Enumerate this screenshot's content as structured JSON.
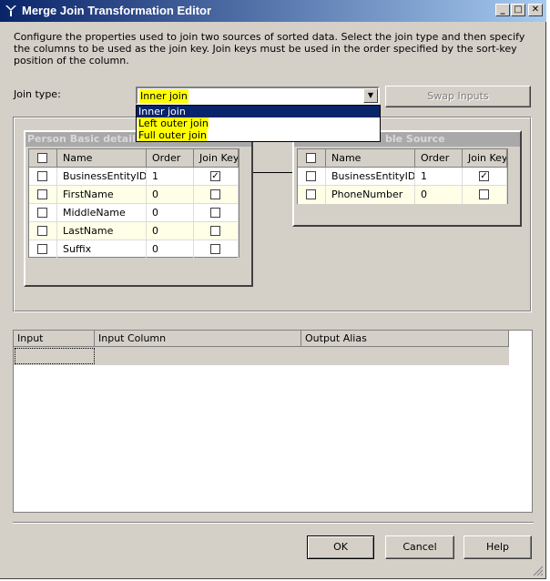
{
  "window": {
    "title": "Merge Join Transformation Editor"
  },
  "description": "Configure the properties used to join two sources of sorted data. Select the join type and then specify the columns to be used as the join key. Join keys must be used in the order specified by the sort-key position of the column.",
  "join_type": {
    "label": "Join type:",
    "selected": "Inner join",
    "options": [
      "Inner join",
      "Left outer join",
      "Full outer join"
    ]
  },
  "swap_inputs_label": "Swap Inputs",
  "left_table": {
    "title": "Person Basic detail S",
    "columns": [
      "Name",
      "Order",
      "Join Key"
    ],
    "rows": [
      {
        "name": "BusinessEntityID",
        "order": "1",
        "join_key": true
      },
      {
        "name": "FirstName",
        "order": "0",
        "join_key": false
      },
      {
        "name": "MiddleName",
        "order": "0",
        "join_key": false
      },
      {
        "name": "LastName",
        "order": "0",
        "join_key": false
      },
      {
        "name": "Suffix",
        "order": "0",
        "join_key": false
      }
    ]
  },
  "right_table": {
    "title": "ble Source",
    "columns": [
      "Name",
      "Order",
      "Join Key"
    ],
    "rows": [
      {
        "name": "BusinessEntityID",
        "order": "1",
        "join_key": true
      },
      {
        "name": "PhoneNumber",
        "order": "0",
        "join_key": false
      }
    ]
  },
  "output_grid": {
    "columns": [
      "Input",
      "Input Column",
      "Output Alias"
    ]
  },
  "buttons": {
    "ok": "OK",
    "cancel": "Cancel",
    "help": "Help"
  },
  "titlebar_buttons": {
    "minimize": "_",
    "maximize": "□",
    "close": "✕"
  },
  "colors": {
    "title_start": "#0a246a",
    "title_end": "#a6caf0",
    "highlight": "#ffff00",
    "selection": "#0a246a",
    "face": "#d4d0c8"
  },
  "icons": [
    "app-icon",
    "minimize-icon",
    "maximize-icon",
    "close-icon",
    "dropdown-arrow-icon",
    "checkbox-icon"
  ]
}
